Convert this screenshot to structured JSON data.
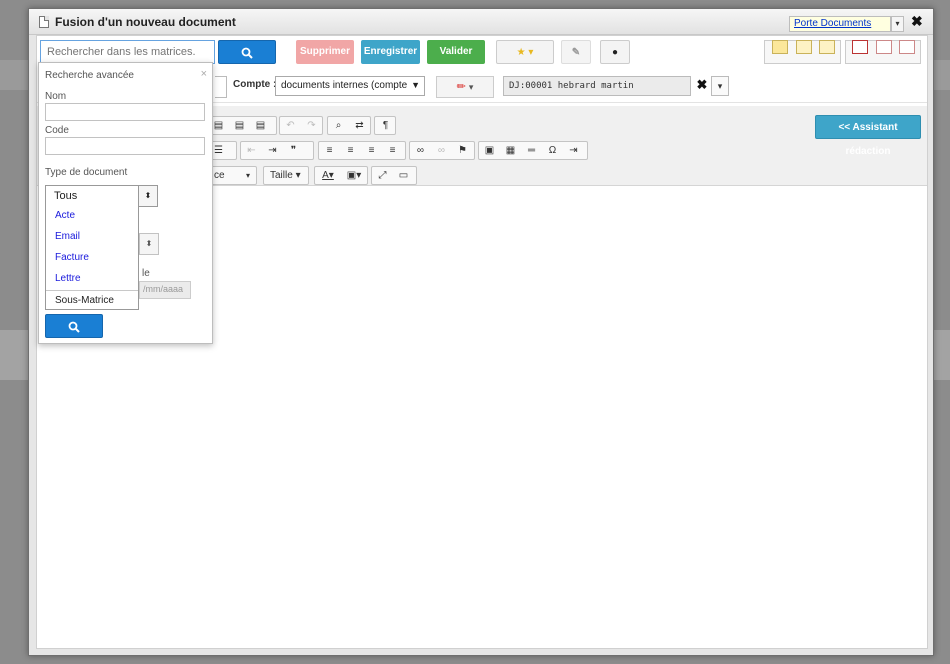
{
  "dialog": {
    "title": "Fusion d'un nouveau document",
    "porte_documents": "Porte Documents",
    "close_glyph": "✖"
  },
  "toolbar": {
    "search_placeholder": "Rechercher dans les matrices.",
    "search_icon": "search-icon",
    "supprimer": "Supprimer",
    "enregistrer": "Enregistrer",
    "valider": "Valider",
    "star_glyph": "★ ▾",
    "mic_glyph": "🎤"
  },
  "compte": {
    "label": "Compte :",
    "value": "documents internes (compte",
    "arrow": "▼"
  },
  "dj": {
    "value": "DJ:00001 hebrard  martin",
    "clear": "✖",
    "arrow": "▾"
  },
  "editor": {
    "assistant": "<< Assistant rédaction",
    "size_label": "Taille ▾",
    "font_fragment": "ce",
    "omega": "Ω"
  },
  "advanced_search": {
    "header": "Recherche avancée",
    "close": "×",
    "name_label": "Nom",
    "code_label": "Code",
    "type_label": "Type de document",
    "type_selected": "Tous",
    "type_options": [
      "Acte",
      "Email",
      "Facture",
      "Lettre",
      "Sous-Matrice"
    ],
    "date_fragment": "le",
    "date_placeholder": "/mm/aaaa"
  },
  "colors": {
    "primary": "#1a7fd4",
    "info": "#3ea5c9",
    "success": "#4cae4c",
    "danger_light": "#f1a6a6"
  }
}
